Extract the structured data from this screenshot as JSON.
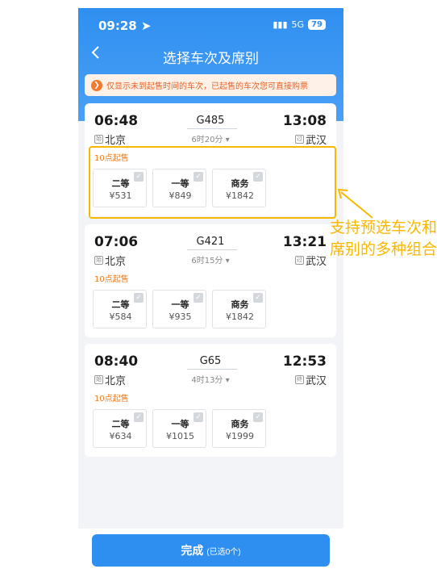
{
  "status": {
    "time": "09:28 ➤",
    "signal": "5G",
    "battery": "79"
  },
  "header": {
    "back_icon": "chevron-left-icon",
    "title": "选择车次及席别"
  },
  "notice": {
    "text": "仅显示未到起售时间的车次，已起售的车次您可直接购票"
  },
  "trains": [
    {
      "depart_time": "06:48",
      "arrive_time": "13:08",
      "train_no": "G485",
      "duration": "6时20分 ▾",
      "from_tag": "始",
      "from": "北京",
      "to_tag": "过",
      "to": "武汉",
      "sale_time": "10点起售",
      "seats": [
        {
          "name": "二等",
          "price": "¥531"
        },
        {
          "name": "一等",
          "price": "¥849"
        },
        {
          "name": "商务",
          "price": "¥1842"
        }
      ]
    },
    {
      "depart_time": "07:06",
      "arrive_time": "13:21",
      "train_no": "G421",
      "duration": "6时15分 ▾",
      "from_tag": "始",
      "from": "北京",
      "to_tag": "过",
      "to": "武汉",
      "sale_time": "10点起售",
      "seats": [
        {
          "name": "二等",
          "price": "¥584"
        },
        {
          "name": "一等",
          "price": "¥935"
        },
        {
          "name": "商务",
          "price": "¥1842"
        }
      ]
    },
    {
      "depart_time": "08:40",
      "arrive_time": "12:53",
      "train_no": "G65",
      "duration": "4时13分 ▾",
      "from_tag": "始",
      "from": "北京",
      "to_tag": "终",
      "to": "武汉",
      "sale_time": "10点起售",
      "seats": [
        {
          "name": "二等",
          "price": "¥634"
        },
        {
          "name": "一等",
          "price": "¥1015"
        },
        {
          "name": "商务",
          "price": "¥1999"
        }
      ]
    }
  ],
  "footer": {
    "done_label": "完成",
    "done_sub": "(已选0个)"
  },
  "annotation": {
    "text": "支持预选车次和席别的多种组合",
    "color": "#f9b800"
  },
  "colors": {
    "primary": "#2f8ff0",
    "sale_orange": "#f07a1a",
    "notice_bg": "#fdf1e8"
  }
}
